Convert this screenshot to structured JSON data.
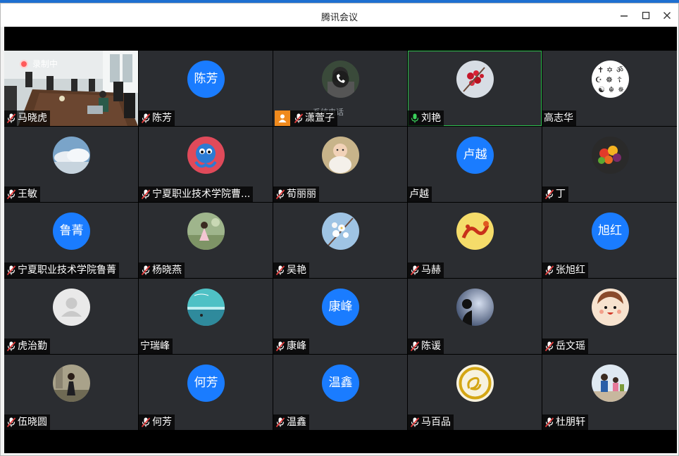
{
  "window": {
    "title": "腾讯会议"
  },
  "recording": {
    "label": "录制中"
  },
  "phone_status": "系统电话",
  "participants": [
    {
      "name": "马晓虎",
      "muted": true,
      "avatar": "room-video"
    },
    {
      "name": "陈芳",
      "muted": true,
      "avatar": "text",
      "text": "陈芳"
    },
    {
      "name": "潇萱子",
      "muted": true,
      "avatar": "phone-photo"
    },
    {
      "name": "刘艳",
      "muted": false,
      "avatar": "red-berries",
      "speaking": true
    },
    {
      "name": "高志华",
      "muted": null,
      "avatar": "religious-symbols"
    },
    {
      "name": "王敏",
      "muted": true,
      "avatar": "cloud-sky"
    },
    {
      "name": "宁夏职业技术学院曹...",
      "muted": true,
      "avatar": "cartoon-octopus"
    },
    {
      "name": "荀丽丽",
      "muted": true,
      "avatar": "baby-photo"
    },
    {
      "name": "卢越",
      "muted": null,
      "avatar": "text",
      "text": "卢越"
    },
    {
      "name": "丁",
      "muted": true,
      "avatar": "fruit-bowl"
    },
    {
      "name": "宁夏职业技术学院鲁菁",
      "muted": true,
      "avatar": "text",
      "text": "鲁菁"
    },
    {
      "name": "杨晓燕",
      "muted": true,
      "avatar": "garden-girl"
    },
    {
      "name": "吴艳",
      "muted": true,
      "avatar": "white-blossom"
    },
    {
      "name": "马赫",
      "muted": true,
      "avatar": "dragon-art"
    },
    {
      "name": "张旭红",
      "muted": true,
      "avatar": "text",
      "text": "旭红"
    },
    {
      "name": "虎治勤",
      "muted": true,
      "avatar": "default-user"
    },
    {
      "name": "宁瑞峰",
      "muted": null,
      "avatar": "beach-scene"
    },
    {
      "name": "康峰",
      "muted": true,
      "avatar": "text",
      "text": "康峰"
    },
    {
      "name": "陈谖",
      "muted": true,
      "avatar": "silhouette-night"
    },
    {
      "name": "岳文瑶",
      "muted": true,
      "avatar": "cartoon-boy"
    },
    {
      "name": "伍晓圆",
      "muted": true,
      "avatar": "woman-outdoor"
    },
    {
      "name": "何芳",
      "muted": true,
      "avatar": "text",
      "text": "何芳"
    },
    {
      "name": "温鑫",
      "muted": true,
      "avatar": "text",
      "text": "温鑫"
    },
    {
      "name": "马百品",
      "muted": true,
      "avatar": "gold-snake-logo"
    },
    {
      "name": "杜朋轩",
      "muted": true,
      "avatar": "cartoon-family"
    }
  ],
  "colors": {
    "tile_bg": "#2b2d31",
    "text_avatar_bg": "#1a7cff",
    "speaking_border": "#2fbf4f",
    "mic_muted_red": "#e23c3c"
  }
}
